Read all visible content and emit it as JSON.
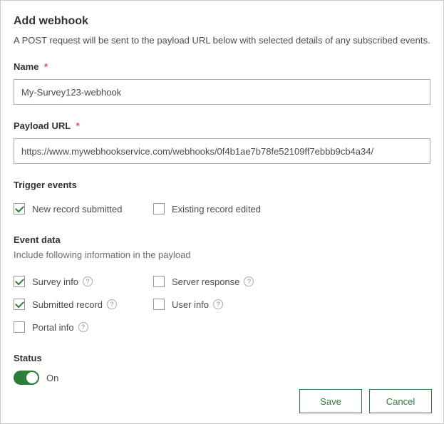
{
  "title": "Add webhook",
  "description": "A POST request will be sent to the payload URL below with selected details of any subscribed events.",
  "required_mark": "*",
  "field_name": {
    "label": "Name",
    "value": "My-Survey123-webhook"
  },
  "field_url": {
    "label": "Payload URL",
    "value": "https://www.mywebhookservice.com/webhooks/0f4b1ae7b78fe52109ff7ebbb9cb4a34/"
  },
  "trigger": {
    "heading": "Trigger events",
    "items": [
      {
        "label": "New record submitted",
        "checked": true
      },
      {
        "label": "Existing record edited",
        "checked": false
      }
    ]
  },
  "event_data": {
    "heading": "Event data",
    "subheading": "Include following information in the payload",
    "items": [
      {
        "label": "Survey info",
        "checked": true,
        "help": true
      },
      {
        "label": "Server response",
        "checked": false,
        "help": true
      },
      {
        "label": "Submitted record",
        "checked": true,
        "help": true
      },
      {
        "label": "User info",
        "checked": false,
        "help": true
      },
      {
        "label": "Portal info",
        "checked": false,
        "help": true
      }
    ]
  },
  "status": {
    "heading": "Status",
    "on_label": "On",
    "enabled": true
  },
  "buttons": {
    "save": "Save",
    "cancel": "Cancel"
  },
  "help_glyph": "?"
}
